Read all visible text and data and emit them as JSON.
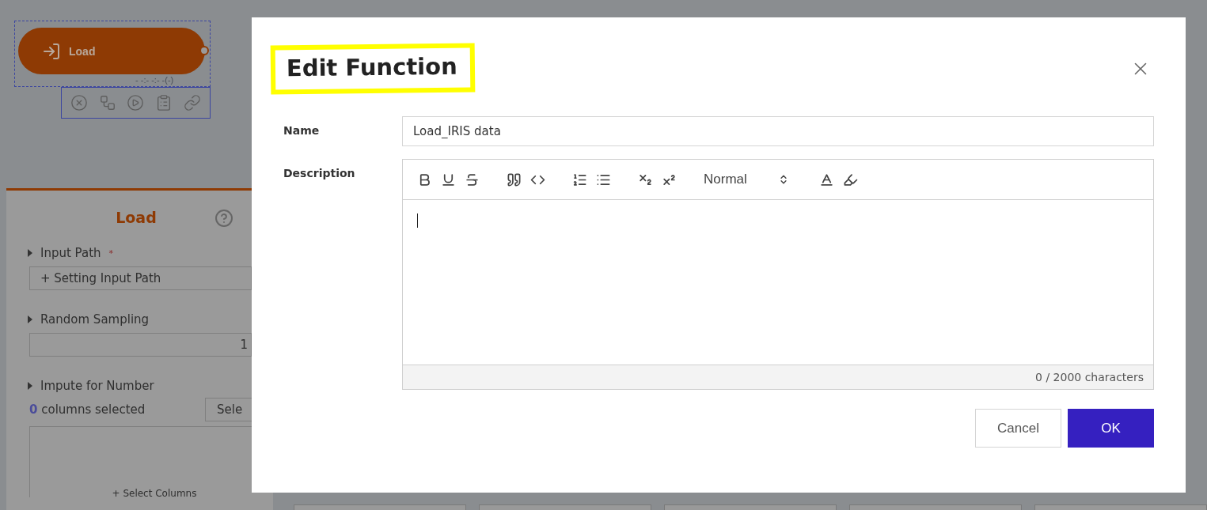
{
  "canvas": {
    "node": {
      "label": "Load",
      "status": "- -:- -:- -(-)",
      "selected": true
    },
    "actions": [
      {
        "kind": "remove"
      },
      {
        "kind": "flow"
      },
      {
        "kind": "run"
      },
      {
        "kind": "notes"
      },
      {
        "kind": "link"
      }
    ]
  },
  "panel": {
    "title": "Load",
    "sections": [
      {
        "kind": "button",
        "label": "Input Path",
        "marker": "*",
        "button": "+ Setting Input Path"
      },
      {
        "kind": "number",
        "label": "Random Sampling",
        "value": "1"
      },
      {
        "kind": "columns",
        "label": "Impute for Number",
        "count": "0",
        "count_text": "columns selected",
        "button": "Sele",
        "add": "+ Select Columns"
      }
    ]
  },
  "dialog": {
    "title": "Edit Function",
    "title_highlighted": true,
    "fields": [
      {
        "kind": "input",
        "label": "Name",
        "value": "Load_IRIS data"
      },
      {
        "kind": "editor",
        "label": "Description",
        "counter": "0 / 2000 characters",
        "toolbar": [
          {
            "kind": "bold"
          },
          {
            "kind": "underline"
          },
          {
            "kind": "strike"
          },
          {
            "kind": "gap"
          },
          {
            "kind": "quote"
          },
          {
            "kind": "code"
          },
          {
            "kind": "gap"
          },
          {
            "kind": "ordered-list"
          },
          {
            "kind": "bullet-list"
          },
          {
            "kind": "gap"
          },
          {
            "kind": "subscript"
          },
          {
            "kind": "superscript"
          },
          {
            "kind": "gap"
          },
          {
            "kind": "select",
            "value": "Normal"
          },
          {
            "kind": "gap"
          },
          {
            "kind": "text-color"
          },
          {
            "kind": "background-color"
          }
        ]
      }
    ],
    "buttons": [
      {
        "kind": "secondary",
        "label": "Cancel"
      },
      {
        "kind": "primary",
        "label": "OK"
      }
    ]
  }
}
